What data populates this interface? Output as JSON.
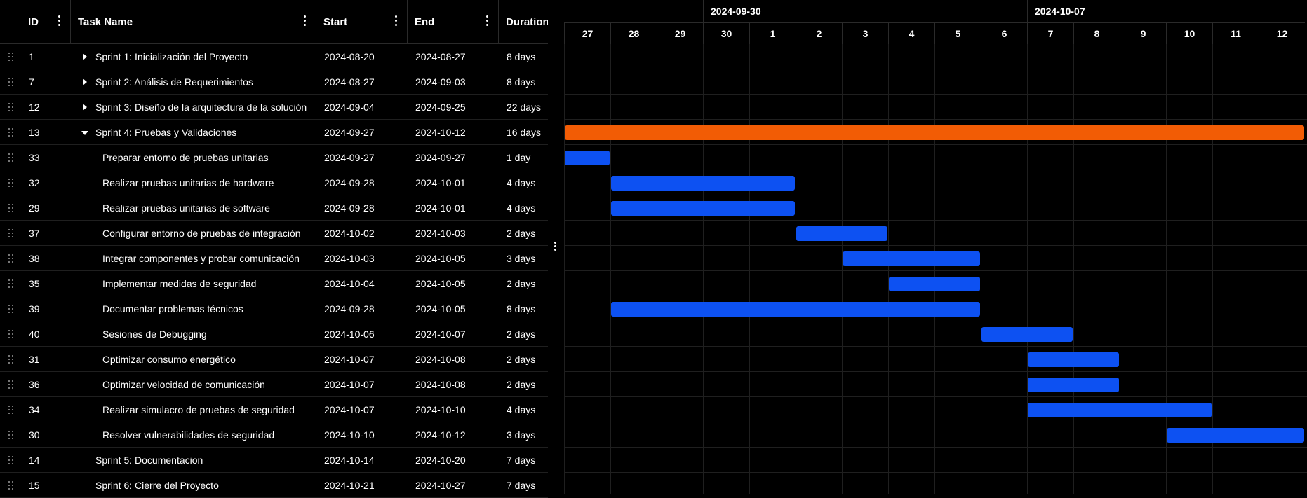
{
  "colors": {
    "parent_bar": "#f25c05",
    "task_bar": "#0d51f2",
    "background": "#000000"
  },
  "columns": {
    "id": "ID",
    "name": "Task Name",
    "start": "Start",
    "end": "End",
    "duration": "Duration"
  },
  "timeline": {
    "weeks": [
      "2024-09-30",
      "2024-10-07"
    ],
    "days": [
      "27",
      "28",
      "29",
      "30",
      "1",
      "2",
      "3",
      "4",
      "5",
      "6",
      "7",
      "8",
      "9",
      "10",
      "11",
      "12"
    ]
  },
  "rows": [
    {
      "id": "1",
      "name": "Sprint 1: Inicialización del Proyecto",
      "start": "2024-08-20",
      "end": "2024-08-27",
      "duration": "8 days",
      "level": 0,
      "toggle": "collapsed"
    },
    {
      "id": "7",
      "name": "Sprint 2: Análisis de Requerimientos",
      "start": "2024-08-27",
      "end": "2024-09-03",
      "duration": "8 days",
      "level": 0,
      "toggle": "collapsed"
    },
    {
      "id": "12",
      "name": "Sprint 3: Diseño de la arquitectura de la solución",
      "start": "2024-09-04",
      "end": "2024-09-25",
      "duration": "22 days",
      "level": 0,
      "toggle": "collapsed"
    },
    {
      "id": "13",
      "name": "Sprint 4: Pruebas y Validaciones",
      "start": "2024-09-27",
      "end": "2024-10-12",
      "duration": "16 days",
      "level": 0,
      "toggle": "expanded"
    },
    {
      "id": "33",
      "name": "Preparar entorno de pruebas unitarias",
      "start": "2024-09-27",
      "end": "2024-09-27",
      "duration": "1 day",
      "level": 1,
      "toggle": "none"
    },
    {
      "id": "32",
      "name": "Realizar pruebas unitarias de hardware",
      "start": "2024-09-28",
      "end": "2024-10-01",
      "duration": "4 days",
      "level": 1,
      "toggle": "none"
    },
    {
      "id": "29",
      "name": "Realizar pruebas unitarias de software",
      "start": "2024-09-28",
      "end": "2024-10-01",
      "duration": "4 days",
      "level": 1,
      "toggle": "none"
    },
    {
      "id": "37",
      "name": "Configurar entorno de pruebas de integración",
      "start": "2024-10-02",
      "end": "2024-10-03",
      "duration": "2 days",
      "level": 1,
      "toggle": "none"
    },
    {
      "id": "38",
      "name": "Integrar componentes y probar comunicación",
      "start": "2024-10-03",
      "end": "2024-10-05",
      "duration": "3 days",
      "level": 1,
      "toggle": "none"
    },
    {
      "id": "35",
      "name": "Implementar medidas de seguridad",
      "start": "2024-10-04",
      "end": "2024-10-05",
      "duration": "2 days",
      "level": 1,
      "toggle": "none"
    },
    {
      "id": "39",
      "name": "Documentar problemas técnicos",
      "start": "2024-09-28",
      "end": "2024-10-05",
      "duration": "8 days",
      "level": 1,
      "toggle": "none"
    },
    {
      "id": "40",
      "name": "Sesiones de Debugging",
      "start": "2024-10-06",
      "end": "2024-10-07",
      "duration": "2 days",
      "level": 1,
      "toggle": "none"
    },
    {
      "id": "31",
      "name": "Optimizar consumo energético",
      "start": "2024-10-07",
      "end": "2024-10-08",
      "duration": "2 days",
      "level": 1,
      "toggle": "none"
    },
    {
      "id": "36",
      "name": "Optimizar velocidad de comunicación",
      "start": "2024-10-07",
      "end": "2024-10-08",
      "duration": "2 days",
      "level": 1,
      "toggle": "none"
    },
    {
      "id": "34",
      "name": "Realizar simulacro de pruebas de seguridad",
      "start": "2024-10-07",
      "end": "2024-10-10",
      "duration": "4 days",
      "level": 1,
      "toggle": "none"
    },
    {
      "id": "30",
      "name": "Resolver vulnerabilidades de seguridad",
      "start": "2024-10-10",
      "end": "2024-10-12",
      "duration": "3 days",
      "level": 1,
      "toggle": "none"
    },
    {
      "id": "14",
      "name": "Sprint 5: Documentacion",
      "start": "2024-10-14",
      "end": "2024-10-20",
      "duration": "7 days",
      "level": 0,
      "toggle": "none"
    },
    {
      "id": "15",
      "name": "Sprint 6: Cierre del Proyecto",
      "start": "2024-10-21",
      "end": "2024-10-27",
      "duration": "7 days",
      "level": 0,
      "toggle": "none"
    }
  ]
}
